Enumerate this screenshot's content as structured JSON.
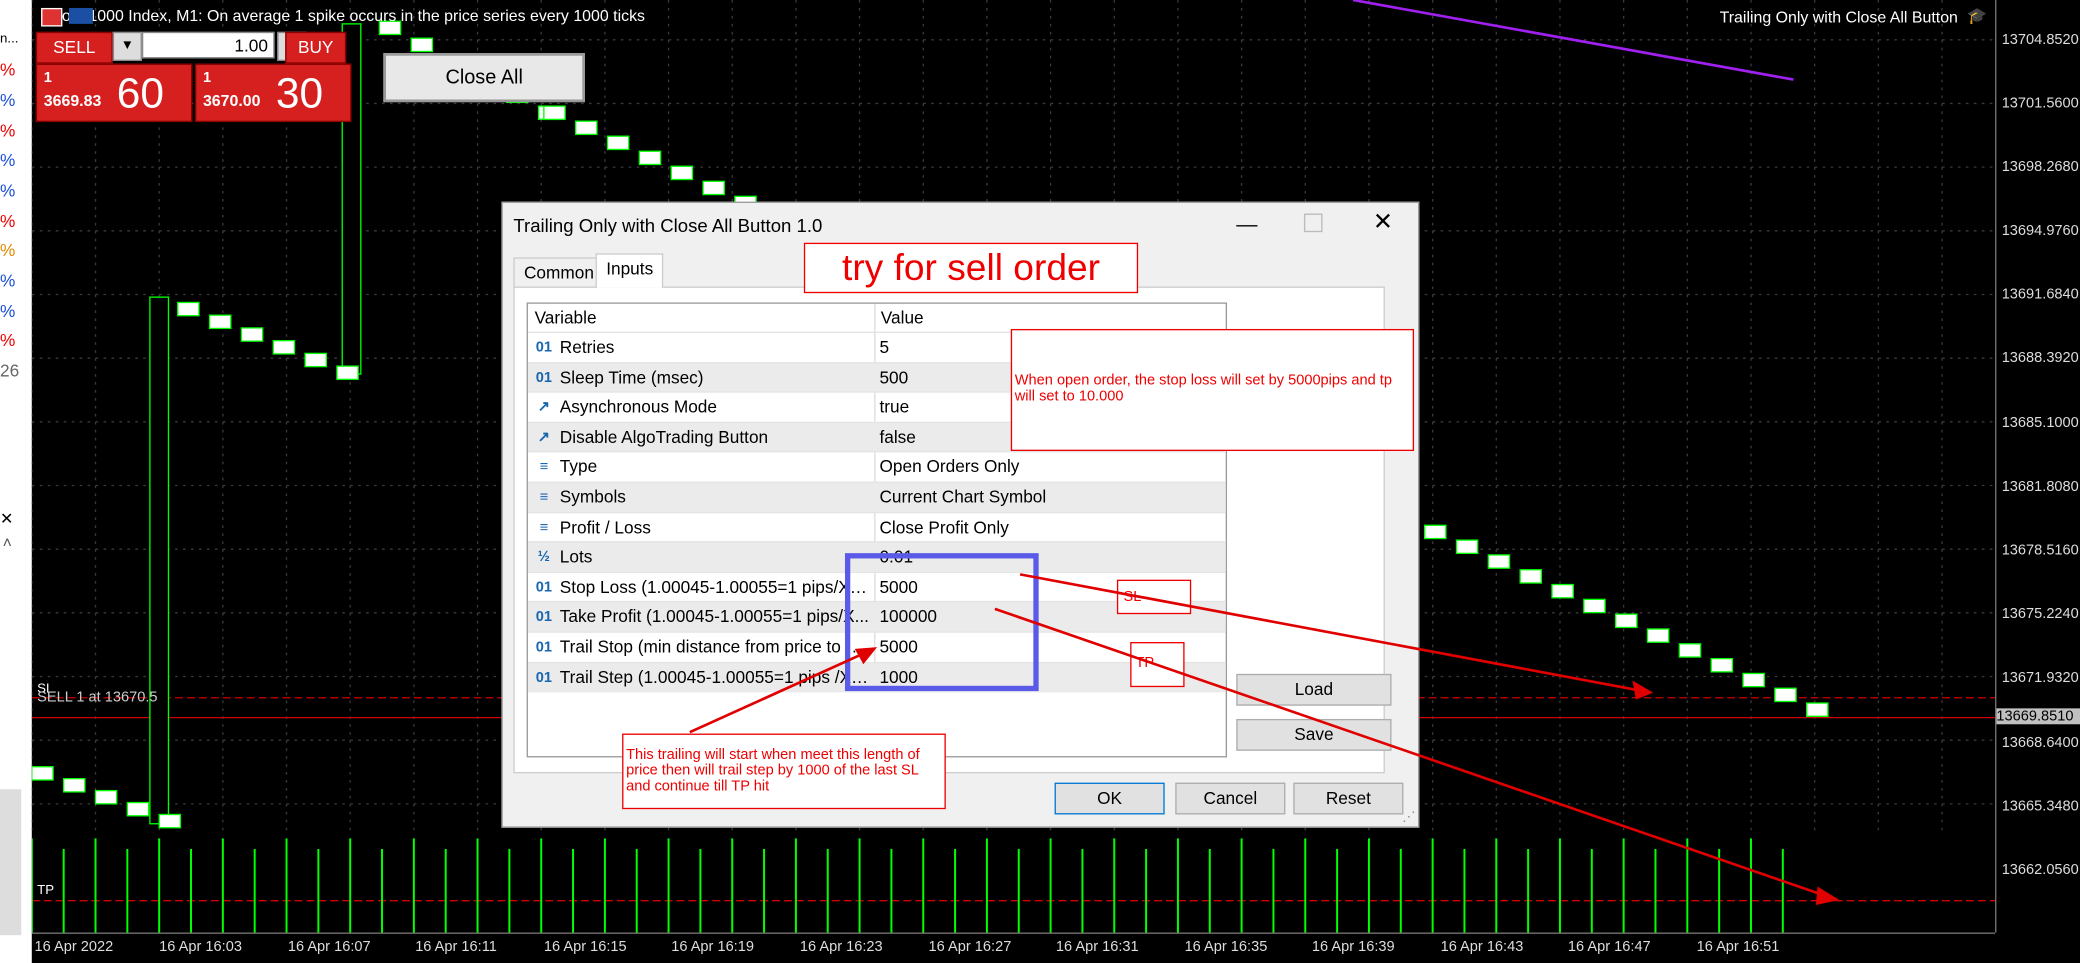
{
  "chart": {
    "title": "Boom 1000 Index, M1:  On average 1 spike occurs in the price series every 1000 ticks",
    "ea_name": "Trailing Only with Close All Button",
    "sl_line_label": "SELL 1 at 13670.5",
    "sl_tag": "SL",
    "tp_tag": "TP",
    "price_labels": [
      "13704.8520",
      "13701.5600",
      "13698.2680",
      "13694.9760",
      "13691.6840",
      "13688.3920",
      "13685.1000",
      "13681.8080",
      "13678.5160",
      "13675.2240",
      "13671.9320",
      "13668.6400",
      "13665.3480",
      "13662.0560"
    ],
    "current_price": "13669.8510",
    "time_labels": [
      "16 Apr 2022",
      "16 Apr 16:03",
      "16 Apr 16:07",
      "16 Apr 16:11",
      "16 Apr 16:15",
      "16 Apr 16:19",
      "16 Apr 16:23",
      "16 Apr 16:27",
      "16 Apr 16:31",
      "16 Apr 16:35",
      "16 Apr 16:39",
      "16 Apr 16:43",
      "16 Apr 16:47",
      "16 Apr 16:51"
    ],
    "colors": {
      "bull": "#00ff00",
      "trend": "#a020f0",
      "level": "#cc0000"
    }
  },
  "left_strip": {
    "items": [
      "n...",
      "%",
      "%",
      "%",
      "%",
      "%",
      "%",
      "%",
      "%",
      "%",
      "%",
      "%",
      "26"
    ]
  },
  "trading": {
    "sell_label": "SELL",
    "buy_label": "BUY",
    "volume": "1.00",
    "sell_prefix": "1",
    "sell_price_small": "3669.83",
    "sell_price_big": "60",
    "buy_prefix": "1",
    "buy_price_small": "3670.00",
    "buy_price_big": "30",
    "close_all": "Close All"
  },
  "dialog": {
    "title": "Trailing Only with Close All Button 1.0",
    "tabs": [
      "Common",
      "Inputs"
    ],
    "col_variable": "Variable",
    "col_value": "Value",
    "rows": [
      {
        "icon": "01",
        "name": "Retries",
        "value": "5"
      },
      {
        "icon": "01",
        "name": "Sleep Time (msec)",
        "value": "500"
      },
      {
        "icon": "↗",
        "name": "Asynchronous Mode",
        "value": "true"
      },
      {
        "icon": "↗",
        "name": "Disable AlgoTrading Button",
        "value": "false"
      },
      {
        "icon": "≡",
        "name": "Type",
        "value": "Open Orders Only"
      },
      {
        "icon": "≡",
        "name": "Symbols",
        "value": "Current Chart Symbol"
      },
      {
        "icon": "≡",
        "name": "Profit / Loss",
        "value": "Close Profit Only"
      },
      {
        "icon": "½",
        "name": "Lots",
        "value": "0.01"
      },
      {
        "icon": "01",
        "name": "Stop Loss (1.00045-1.00055=1 pips/XA...",
        "value": "5000"
      },
      {
        "icon": "01",
        "name": "Take Profit (1.00045-1.00055=1 pips/X...",
        "value": "100000"
      },
      {
        "icon": "01",
        "name": "Trail Stop (min distance from price to Sto...",
        "value": "5000"
      },
      {
        "icon": "01",
        "name": "Trail Step (1.00045-1.00055=1 pips /XA...",
        "value": "1000"
      }
    ],
    "load": "Load",
    "save": "Save",
    "ok": "OK",
    "cancel": "Cancel",
    "reset": "Reset"
  },
  "annotations": {
    "heading": "try for sell order",
    "note_sl_tp": "When open order, the stop loss will set by 5000pips and tp will set to 10.000",
    "sl": "SL",
    "tp": "TP",
    "note_trailing": "This trailing will start when meet this length of price then will trail step by 1000 of the last SL and continue till TP hit"
  }
}
